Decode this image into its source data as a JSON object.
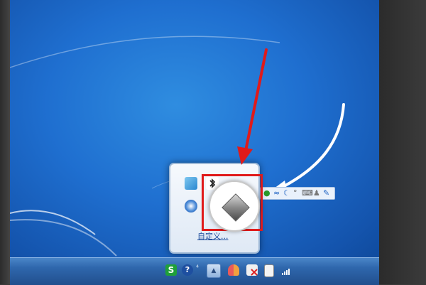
{
  "popup": {
    "customize_label": "自定义..."
  },
  "taskbar": {
    "help_glyph": "?",
    "show_hidden_glyph": "▲"
  },
  "icons": {
    "tray": [
      "sogou-input-icon",
      "help-icon",
      "network-connection-icon",
      "show-hidden-icons-icon",
      "user-accounts-icon",
      "network-error-icon",
      "battery-power-icon",
      "signal-bars-icon"
    ],
    "popup": [
      "screen-tool-icon",
      "bluetooth-icon",
      "media-player-icon",
      "internet-explorer-icon",
      "gray-diamond-icon"
    ]
  },
  "colors": {
    "desktop": "#1f6fd0",
    "taskbar": "#2f67ad",
    "highlight": "#e01a1a",
    "annotation_arrow": "#e01a1a",
    "curve_arrow": "#ffffff"
  }
}
